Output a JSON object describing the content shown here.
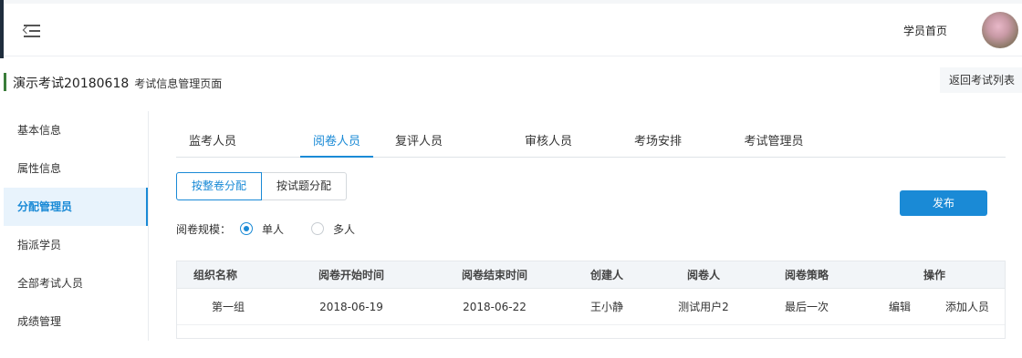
{
  "header": {
    "home_label": "学员首页",
    "menu_icon": "menu-fold-icon",
    "avatar_icon": "user-avatar"
  },
  "title_bar": {
    "title": "演示考试20180618",
    "subtitle": "考试信息管理页面",
    "back_label": "返回考试列表",
    "accent_color": "#3a7d3a"
  },
  "sidebar": {
    "items": [
      {
        "label": "基本信息"
      },
      {
        "label": "属性信息"
      },
      {
        "label": "分配管理员",
        "active": true
      },
      {
        "label": "指派学员"
      },
      {
        "label": "全部考试人员"
      },
      {
        "label": "成绩管理"
      }
    ]
  },
  "tabs": [
    {
      "label": "监考人员"
    },
    {
      "label": "阅卷人员",
      "active": true
    },
    {
      "label": "复评人员"
    },
    {
      "label": "审核人员"
    },
    {
      "label": "考场安排"
    },
    {
      "label": "考试管理员"
    }
  ],
  "assign_modes": {
    "by_paper": "按整卷分配",
    "by_question": "按试题分配",
    "selected": "按整卷分配"
  },
  "publish_label": "发布",
  "grading_scale": {
    "label": "阅卷规模：",
    "options": [
      "单人",
      "多人"
    ],
    "selected": "单人"
  },
  "table": {
    "columns": [
      "组织名称",
      "阅卷开始时间",
      "阅卷结束时间",
      "创建人",
      "阅卷人",
      "阅卷策略",
      "操作"
    ],
    "rows": [
      {
        "group": "第一组",
        "start": "2018-06-19",
        "end": "2018-06-22",
        "creator": "王小静",
        "grader": "测试用户2",
        "strategy": "最后一次",
        "actions": [
          "编辑",
          "添加人员"
        ]
      }
    ]
  },
  "colors": {
    "primary": "#1a8ad6",
    "sidebar_active_bg": "#e8f3fc",
    "table_header_bg": "#f2f5f8"
  }
}
